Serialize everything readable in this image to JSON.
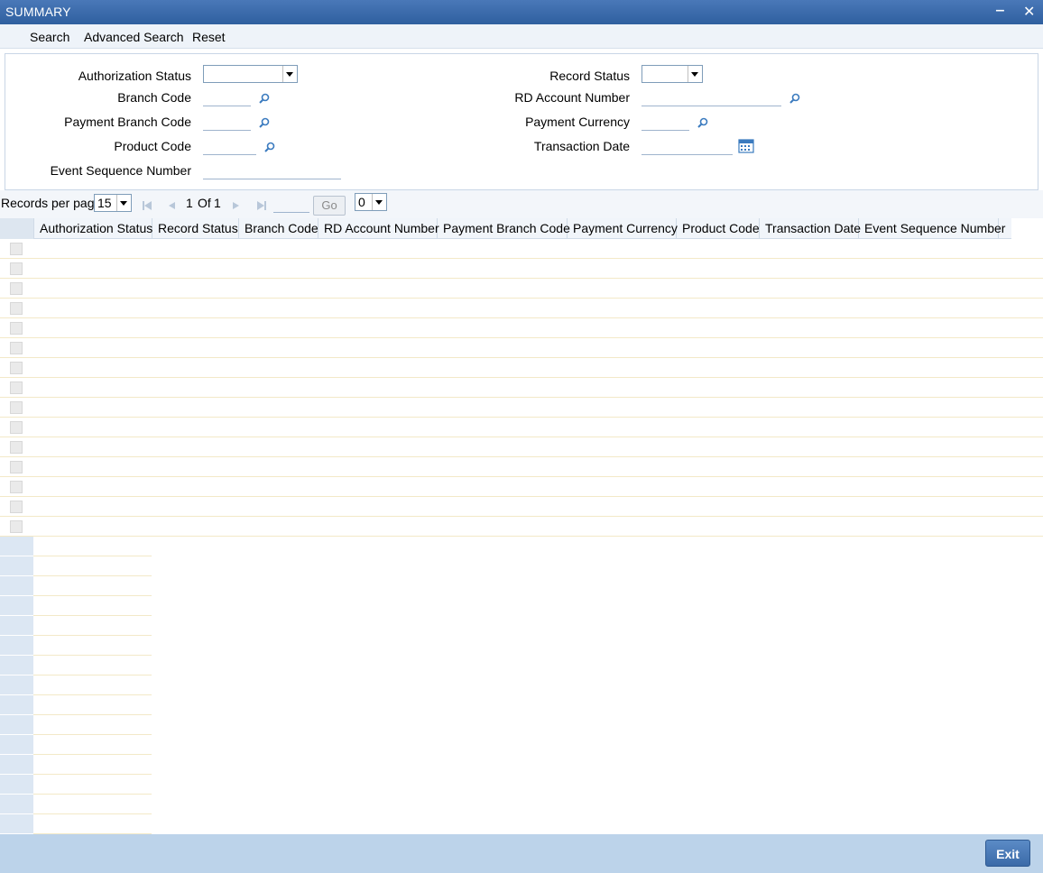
{
  "window": {
    "title": "SUMMARY",
    "minimize_glyph": "‒",
    "close_glyph": "✕"
  },
  "menu": {
    "search": "Search",
    "advanced_search": "Advanced Search",
    "reset": "Reset"
  },
  "criteria": {
    "authorization_status": {
      "label": "Authorization Status",
      "value": ""
    },
    "branch_code": {
      "label": "Branch Code",
      "value": ""
    },
    "payment_branch_code": {
      "label": "Payment Branch Code",
      "value": ""
    },
    "product_code": {
      "label": "Product Code",
      "value": ""
    },
    "event_sequence_number": {
      "label": "Event Sequence Number",
      "value": ""
    },
    "record_status": {
      "label": "Record Status",
      "value": ""
    },
    "rd_account_number": {
      "label": "RD Account Number",
      "value": ""
    },
    "payment_currency": {
      "label": "Payment Currency",
      "value": ""
    },
    "transaction_date": {
      "label": "Transaction Date",
      "value": ""
    }
  },
  "pager": {
    "records_per_page_label": "Records per page",
    "records_per_page_value": "15",
    "current_page": "1",
    "of_label": "Of",
    "total_pages": "1",
    "go_label": "Go",
    "goto_page_value": "",
    "second_select_value": "0"
  },
  "grid": {
    "columns": [
      "Authorization Status",
      "Record Status",
      "Branch Code",
      "RD Account Number",
      "Payment Branch Code",
      "Payment Currency",
      "Product Code",
      "Transaction Date",
      "Event Sequence Number"
    ],
    "rows": []
  },
  "footer": {
    "exit_label": "Exit"
  },
  "colors": {
    "titlebar": "#2f5f9f",
    "footer": "#bcd3ea",
    "accent_icon": "#3b7bbf"
  },
  "icons": {
    "lookup": "search-icon",
    "calendar": "calendar-icon",
    "first": "first-page-icon",
    "prev": "previous-page-icon",
    "next": "next-page-icon",
    "last": "last-page-icon"
  }
}
